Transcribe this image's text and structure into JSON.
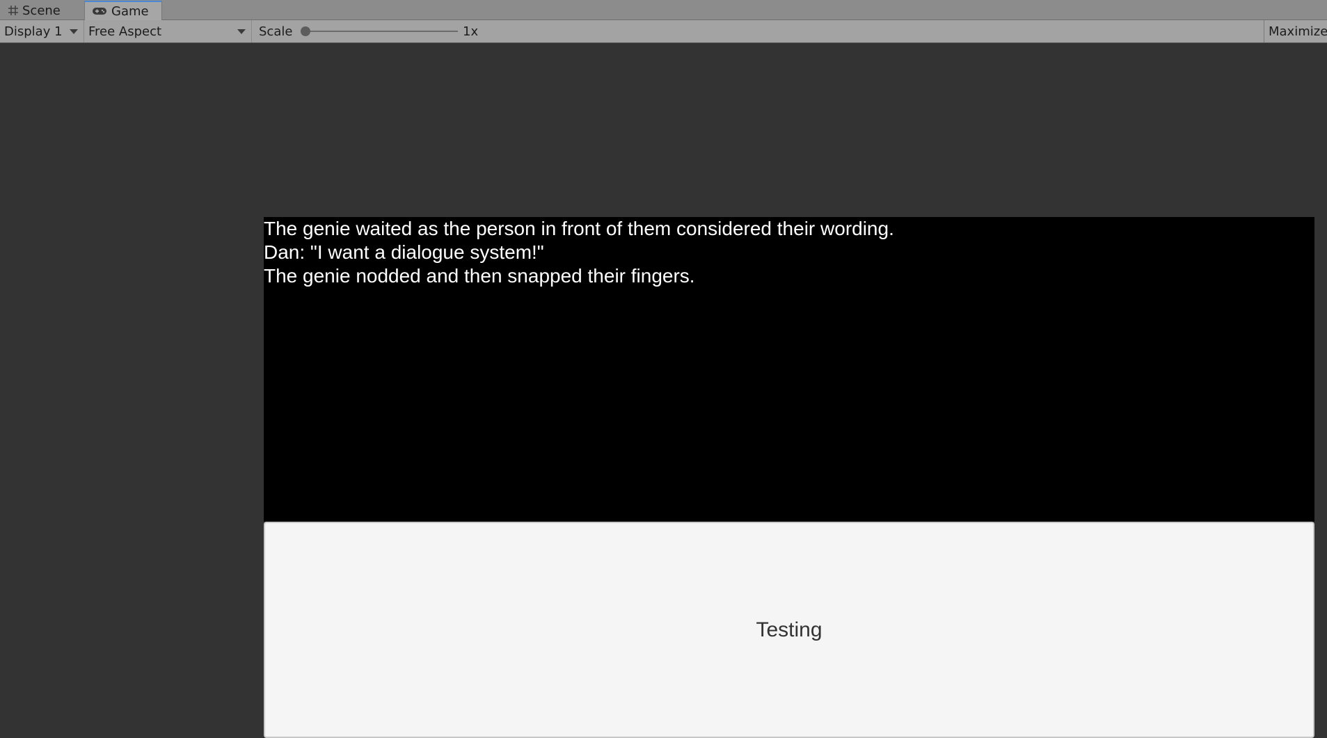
{
  "tabs": [
    {
      "label": "Scene",
      "icon": "grid-icon"
    },
    {
      "label": "Game",
      "icon": "gamepad-icon",
      "active": true
    }
  ],
  "toolbar": {
    "display": "Display 1",
    "aspect": "Free Aspect",
    "scale_label": "Scale",
    "scale_value": "1x",
    "maximize": "Maximize"
  },
  "game": {
    "dialog_lines": [
      "The genie waited as the person in front of them considered their wording.",
      "Dan: \"I want a dialogue system!\"",
      "The genie nodded and then snapped their fingers."
    ],
    "option_button": "Testing"
  },
  "colors": {
    "viewport_bg": "#333333",
    "dialog_bg": "#000000",
    "dialog_text": "#ffffff",
    "button_bg": "#f5f5f5",
    "active_tab_accent": "#4a8ad4"
  }
}
